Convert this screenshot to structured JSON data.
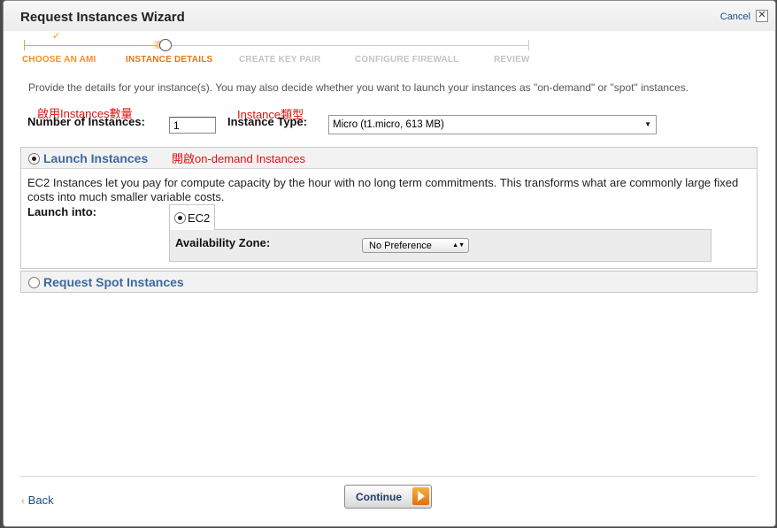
{
  "dialog": {
    "title": "Request Instances Wizard",
    "cancel_label": "Cancel",
    "close_glyph": "✕"
  },
  "steps": [
    {
      "label": "CHOOSE AN AMI",
      "state": "done"
    },
    {
      "label": "INSTANCE DETAILS",
      "state": "active"
    },
    {
      "label": "CREATE KEY PAIR",
      "state": "todo"
    },
    {
      "label": "CONFIGURE FIREWALL",
      "state": "todo"
    },
    {
      "label": "REVIEW",
      "state": "todo"
    }
  ],
  "check_glyph": "✓",
  "description": "Provide the details for your instance(s). You may also decide whether you want to launch your instances as \"on-demand\" or \"spot\" instances.",
  "fields": {
    "num_instances_label": "Number of Instances:",
    "num_instances_value": "1",
    "num_instances_annotation": "啟用Instances數量",
    "instance_type_label": "Instance Type:",
    "instance_type_annotation": "Instance類型",
    "instance_type_value": "Micro (t1.micro, 613 MB)"
  },
  "launch_panel": {
    "title": "Launch Instances",
    "selected": true,
    "annotation": "開啟on-demand Instances",
    "body": "EC2 Instances let you pay for compute capacity by the hour with no long term commitments. This transforms what are commonly large fixed costs into much smaller variable costs.",
    "launch_into_label": "Launch into:",
    "ec2_tab_label": "EC2",
    "availability_zone_label": "Availability Zone:",
    "availability_zone_value": "No Preference"
  },
  "spot_panel": {
    "title": "Request Spot Instances",
    "selected": false
  },
  "footer": {
    "back_label": "Back",
    "continue_label": "Continue"
  },
  "colors": {
    "accent_orange": "#f09020",
    "link_blue": "#1a4d8c",
    "panel_title_blue": "#3c6a9e",
    "annotation_red": "#e01010"
  }
}
